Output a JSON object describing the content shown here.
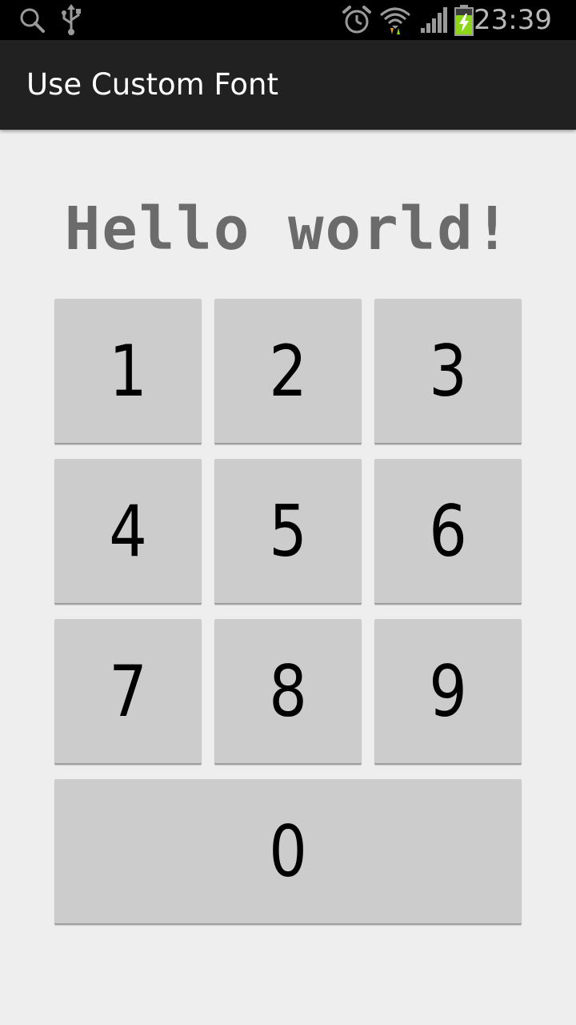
{
  "status_bar": {
    "time": "23:39",
    "icons": [
      "search-icon",
      "usb-icon",
      "alarm-icon",
      "wifi-icon",
      "signal-icon",
      "battery-charging-icon"
    ]
  },
  "action_bar": {
    "title": "Use Custom Font"
  },
  "headline": "Hello world!",
  "keypad": {
    "keys": [
      "1",
      "2",
      "3",
      "4",
      "5",
      "6",
      "7",
      "8",
      "9",
      "0"
    ]
  },
  "colors": {
    "status_bar_bg": "#000000",
    "action_bar_bg": "#212121",
    "page_bg": "#eeeeee",
    "key_bg": "#cccccc",
    "headline_text": "#6b6b6b",
    "battery_accent": "#8ed61a"
  }
}
